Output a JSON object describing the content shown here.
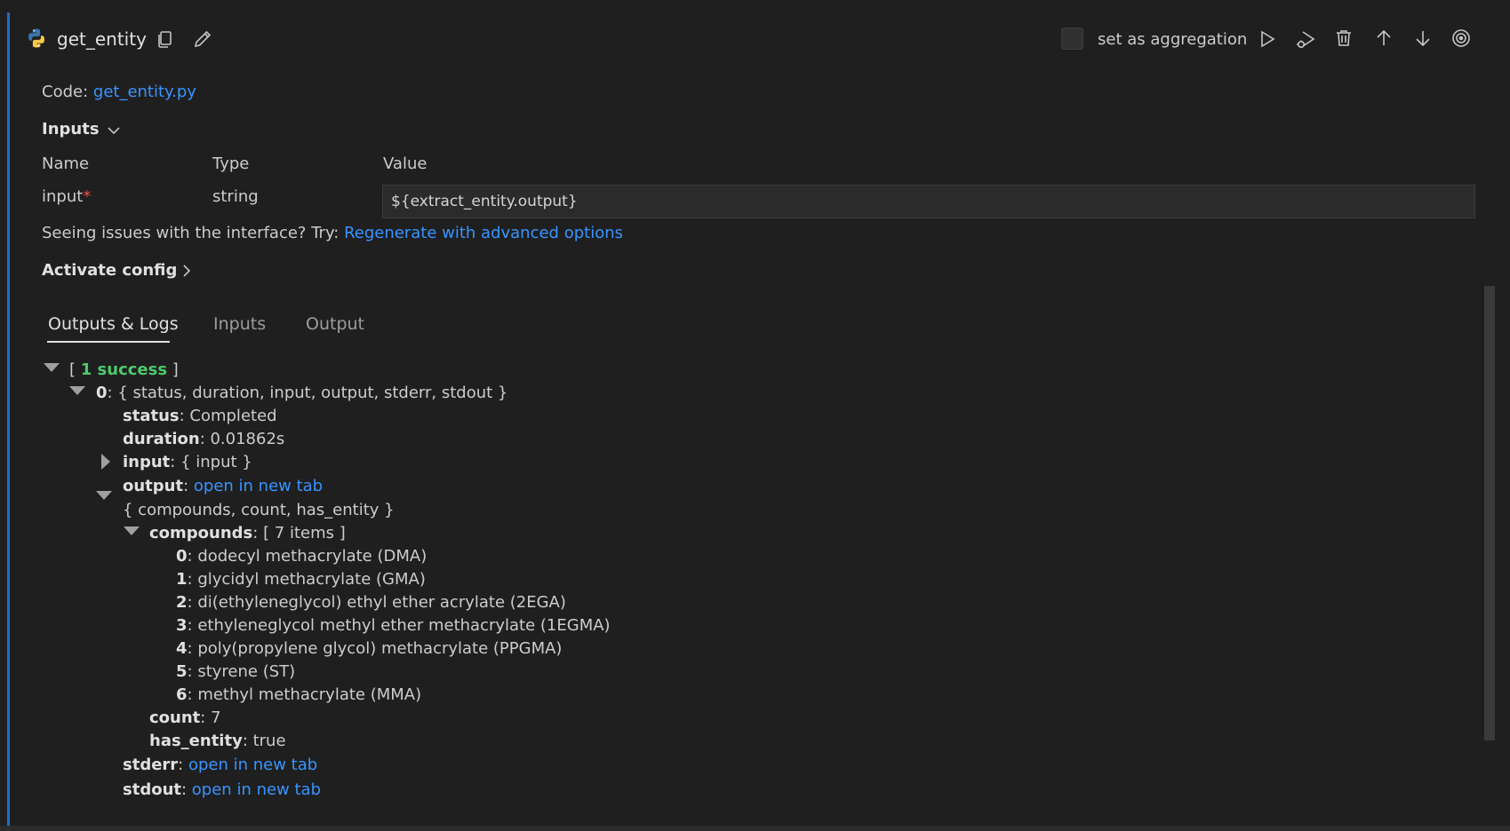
{
  "header": {
    "title": "get_entity",
    "aggregation_label": "set as aggregation"
  },
  "code": {
    "label": "Code:",
    "file": "get_entity.py"
  },
  "inputs": {
    "section_label": "Inputs",
    "columns": [
      "Name",
      "Type",
      "Value"
    ],
    "rows": [
      {
        "name": "input",
        "required_mark": "*",
        "type": "string",
        "value": "${extract_entity.output}"
      }
    ]
  },
  "issues": {
    "text": "Seeing issues with the interface? Try:",
    "link": "Regenerate with advanced options"
  },
  "activate_config": {
    "label": "Activate config"
  },
  "tabs": [
    "Outputs & Logs",
    "Inputs",
    "Output"
  ],
  "results": {
    "open_bracket": "[",
    "close_bracket": "]",
    "summary": "1 success",
    "item_index": "0",
    "item_keys": ": { status, duration, input, output, stderr, stdout }",
    "status_key": "status",
    "status_value": ": Completed",
    "duration_key": "duration",
    "duration_value": ": 0.01862s",
    "input_key": "input",
    "input_value": ": { input }",
    "output_key": "output",
    "output_sep": ": ",
    "open_link": "open in new tab",
    "output_keys": "{ compounds, count, has_entity }",
    "compounds_key": "compounds",
    "compounds_value": ": [ 7 items ]",
    "compounds": [
      {
        "index": "0",
        "value": ": dodecyl methacrylate (DMA)"
      },
      {
        "index": "1",
        "value": ": glycidyl methacrylate (GMA)"
      },
      {
        "index": "2",
        "value": ": di(ethyleneglycol) ethyl ether acrylate (2EGA)"
      },
      {
        "index": "3",
        "value": ": ethyleneglycol methyl ether methacrylate (1EGMA)"
      },
      {
        "index": "4",
        "value": ": poly(propylene glycol) methacrylate (PPGMA)"
      },
      {
        "index": "5",
        "value": ": styrene (ST)"
      },
      {
        "index": "6",
        "value": ": methyl methacrylate (MMA)"
      }
    ],
    "count_key": "count",
    "count_value": ": 7",
    "has_entity_key": "has_entity",
    "has_entity_value": ": true",
    "stderr_key": "stderr",
    "stdout_key": "stdout"
  },
  "colors": {
    "background": "#1f1f1f",
    "link": "#3794ff",
    "success": "#4ec96b",
    "accent": "#1e6fbf",
    "required": "#f14c4c"
  },
  "icons": [
    "python-icon",
    "copy-icon",
    "edit-icon",
    "run-icon",
    "debug-icon",
    "delete-icon",
    "arrow-up-icon",
    "arrow-down-icon",
    "target-icon"
  ]
}
